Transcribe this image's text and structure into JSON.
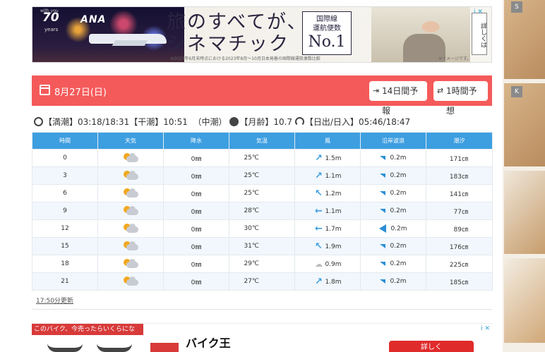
{
  "top_ad": {
    "withyou": "with you",
    "brand_number": "70",
    "years": "years",
    "airline": "ANA",
    "headline_line1": "旅のすべてが、",
    "headline_line2": "シネマチック",
    "badge_line1": "国際線",
    "badge_line2": "運航便数",
    "badge_number": "No.1",
    "side_label": "詳しくは",
    "footnote": "※2023年6月末時点における2023年8月〜10月日本発着の国際線運航便数比較",
    "image_note": "※イメージです。",
    "adchoices": "i ✕"
  },
  "side_ad": {
    "tag1": "S",
    "tag2": "K"
  },
  "header": {
    "date": "8月27日(日)",
    "btn_14day": "14日間予報",
    "btn_1hour": "1時間予想",
    "accent_color": "#f55a5a"
  },
  "tide_info": {
    "high_label": "【満潮】",
    "high_value": "03:18/18:31",
    "low_label": "【干潮】",
    "low_value": "10:51",
    "tide_type": "（中潮）",
    "moon_label": "【月齢】",
    "moon_value": "10.7",
    "sun_label": "【日出/日入】",
    "sun_value": "05:46/18:47"
  },
  "table": {
    "headers": [
      "時間",
      "天気",
      "降水",
      "気温",
      "風",
      "沿岸波浪",
      "潮汐"
    ],
    "header_color": "#3d9ee0",
    "rows": [
      {
        "time": "0",
        "weather": "cloudy-sun-icon",
        "precip": "0㎜",
        "temp": "25℃",
        "wind_dir": "↗",
        "wind": "1.5m",
        "wave_dir": "sw",
        "wave": "0.2m",
        "tide": "171㎝"
      },
      {
        "time": "3",
        "weather": "cloudy-sun-icon",
        "precip": "0㎜",
        "temp": "25℃",
        "wind_dir": "↗",
        "wind": "1.1m",
        "wave_dir": "sw",
        "wave": "0.2m",
        "tide": "183㎝"
      },
      {
        "time": "6",
        "weather": "cloudy-sun-icon",
        "precip": "0㎜",
        "temp": "25℃",
        "wind_dir": "↖",
        "wind": "1.2m",
        "wave_dir": "sw",
        "wave": "0.2m",
        "tide": "141㎝"
      },
      {
        "time": "9",
        "weather": "cloudy-sun-icon",
        "precip": "0㎜",
        "temp": "28℃",
        "wind_dir": "←",
        "wind": "1.1m",
        "wave_dir": "sw",
        "wave": "0.2m",
        "tide": "77㎝"
      },
      {
        "time": "12",
        "weather": "cloudy-sun-icon",
        "precip": "0㎜",
        "temp": "30℃",
        "wind_dir": "←",
        "wind": "1.7m",
        "wave_dir": "w",
        "wave": "0.2m",
        "tide": "89㎝"
      },
      {
        "time": "15",
        "weather": "cloudy-sun-icon",
        "precip": "0㎜",
        "temp": "31℃",
        "wind_dir": "↖",
        "wind": "1.9m",
        "wave_dir": "sw",
        "wave": "0.2m",
        "tide": "176㎝"
      },
      {
        "time": "18",
        "weather": "cloudy-sun-icon",
        "precip": "0㎜",
        "temp": "29℃",
        "wind_dir": "calm",
        "wind": "0.9m",
        "wave_dir": "sw",
        "wave": "0.2m",
        "tide": "225㎝"
      },
      {
        "time": "21",
        "weather": "cloudy-sun-icon",
        "precip": "0㎜",
        "temp": "27℃",
        "wind_dir": "↗",
        "wind": "1.8m",
        "wave_dir": "sw",
        "wave": "0.2m",
        "tide": "185㎝"
      }
    ]
  },
  "updated": "17:50分更新",
  "bottom_ad": {
    "question": "このバイク、今売ったらいくらになる?",
    "title": "バイク王",
    "cta": "詳しく",
    "adchoices": "i ✕"
  }
}
